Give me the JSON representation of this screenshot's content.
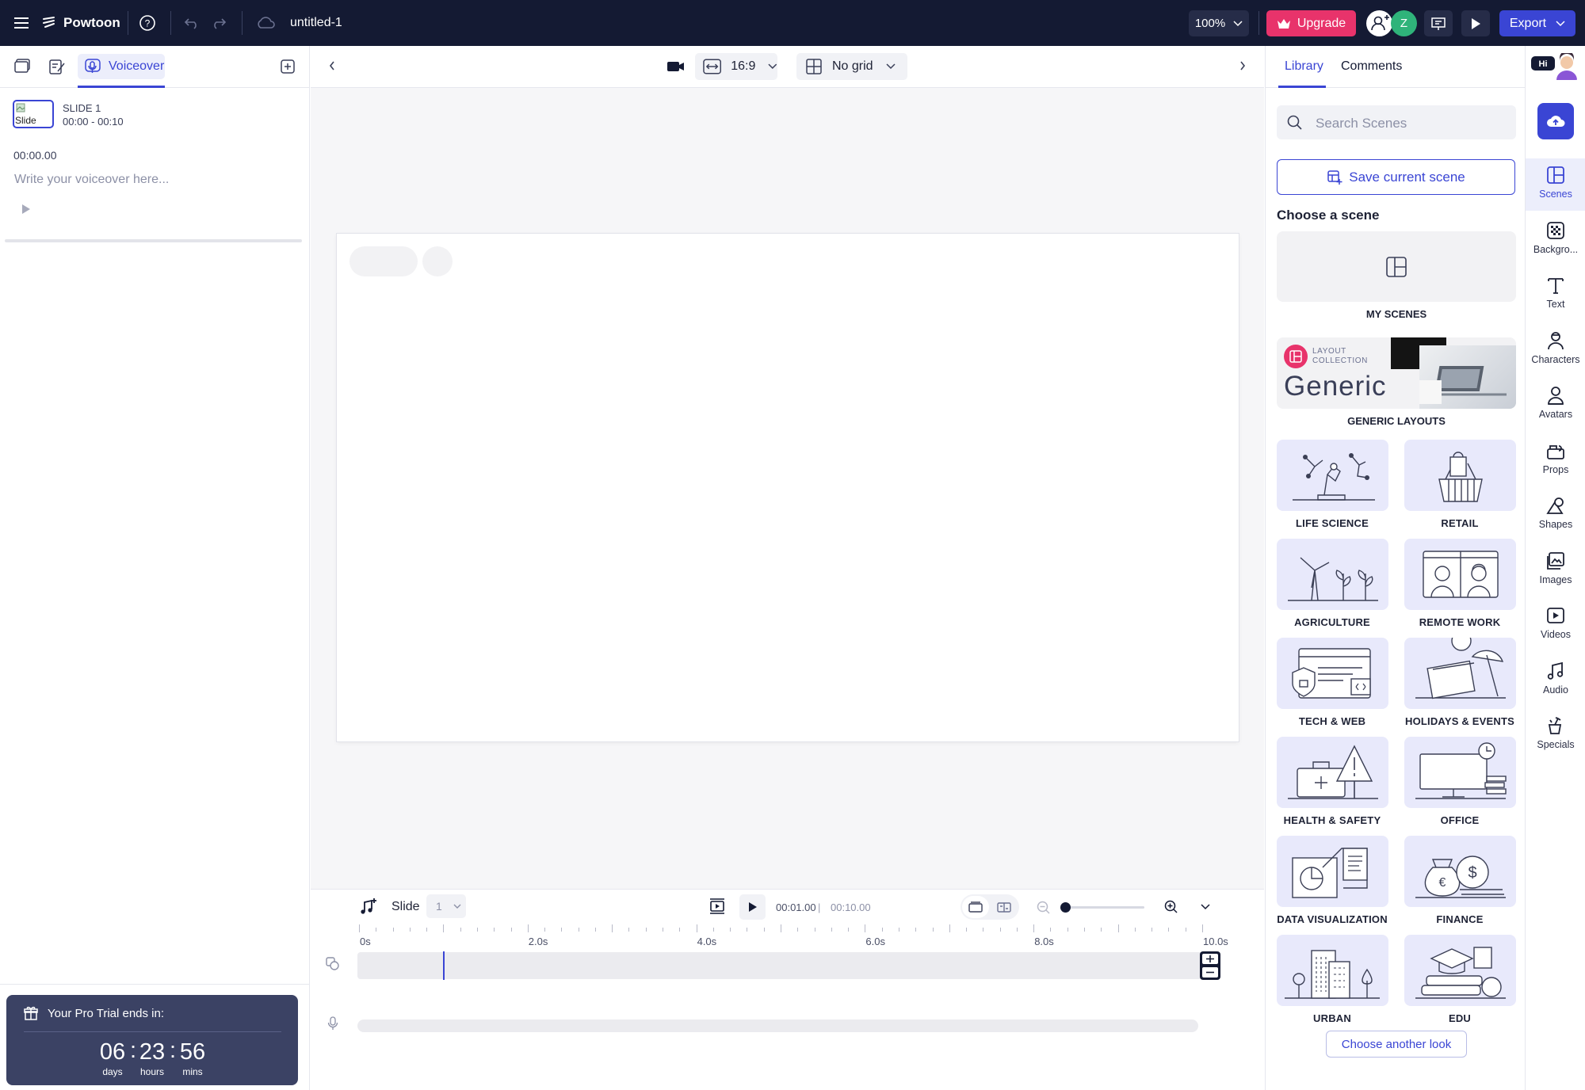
{
  "app": {
    "brand": "Powtoon",
    "file_title": "untitled-1",
    "zoom": "100%",
    "upgrade_label": "Upgrade",
    "export_label": "Export",
    "avatar_initial": "Z",
    "colors": {
      "topbar": "#141a33",
      "upgrade": "#e8336b",
      "export": "#3a45d4",
      "accent": "#3a45d4",
      "avatar": "#2fb37a"
    }
  },
  "left_panel": {
    "voiceover_tab": "Voiceover",
    "slide_thumb_alt": "Slide",
    "slide_title": "SLIDE 1",
    "slide_range": "00:00 - 00:10",
    "voiceover_time": "00:00.00",
    "voiceover_placeholder": "Write your voiceover here...",
    "trial": {
      "title": "Your Pro Trial ends in:",
      "days": "06",
      "hours": "23",
      "mins": "56",
      "days_label": "days",
      "hours_label": "hours",
      "mins_label": "mins"
    }
  },
  "toolbar": {
    "aspect": "16:9",
    "grid": "No grid"
  },
  "timeline": {
    "slide_label": "Slide",
    "slide_number": "1",
    "current_time": "00:01.00",
    "total_time": "00:10.00",
    "ticks": [
      "0s",
      "2.0s",
      "4.0s",
      "6.0s",
      "8.0s",
      "10.0s"
    ],
    "zoom_level": 0.0
  },
  "library": {
    "tabs": [
      "Library",
      "Comments"
    ],
    "search_placeholder": "Search Scenes",
    "save_scene_label": "Save current scene",
    "choose_heading": "Choose a scene",
    "my_scenes_label": "MY SCENES",
    "generic": {
      "badge_line1": "LAYOUT",
      "badge_line2": "COLLECTION",
      "title": "Generic",
      "label": "GENERIC LAYOUTS"
    },
    "scenes": [
      {
        "label": "LIFE SCIENCE",
        "icon": "microscope-icon"
      },
      {
        "label": "RETAIL",
        "icon": "shopping-basket-icon"
      },
      {
        "label": "AGRICULTURE",
        "icon": "windmill-plants-icon"
      },
      {
        "label": "REMOTE WORK",
        "icon": "video-call-icon"
      },
      {
        "label": "TECH & WEB",
        "icon": "browser-code-icon"
      },
      {
        "label": "HOLIDAYS & EVENTS",
        "icon": "calendar-umbrella-icon"
      },
      {
        "label": "HEALTH & SAFETY",
        "icon": "first-aid-warning-icon"
      },
      {
        "label": "OFFICE",
        "icon": "monitor-clock-icon"
      },
      {
        "label": "DATA VISUALIZATION",
        "icon": "chart-document-icon"
      },
      {
        "label": "FINANCE",
        "icon": "money-bag-coins-icon"
      },
      {
        "label": "URBAN",
        "icon": "city-buildings-icon"
      },
      {
        "label": "EDU",
        "icon": "graduation-books-icon"
      }
    ],
    "choose_another_label": "Choose another look"
  },
  "rail": [
    {
      "label": "Scenes",
      "icon": "scenes-icon"
    },
    {
      "label": "Backgro...",
      "icon": "background-icon"
    },
    {
      "label": "Text",
      "icon": "text-icon"
    },
    {
      "label": "Characters",
      "icon": "characters-icon"
    },
    {
      "label": "Avatars",
      "icon": "avatars-icon"
    },
    {
      "label": "Props",
      "icon": "props-icon"
    },
    {
      "label": "Shapes",
      "icon": "shapes-icon"
    },
    {
      "label": "Images",
      "icon": "images-icon"
    },
    {
      "label": "Videos",
      "icon": "videos-icon"
    },
    {
      "label": "Audio",
      "icon": "audio-icon"
    },
    {
      "label": "Specials",
      "icon": "specials-icon"
    }
  ],
  "hi_badge": "Hi"
}
